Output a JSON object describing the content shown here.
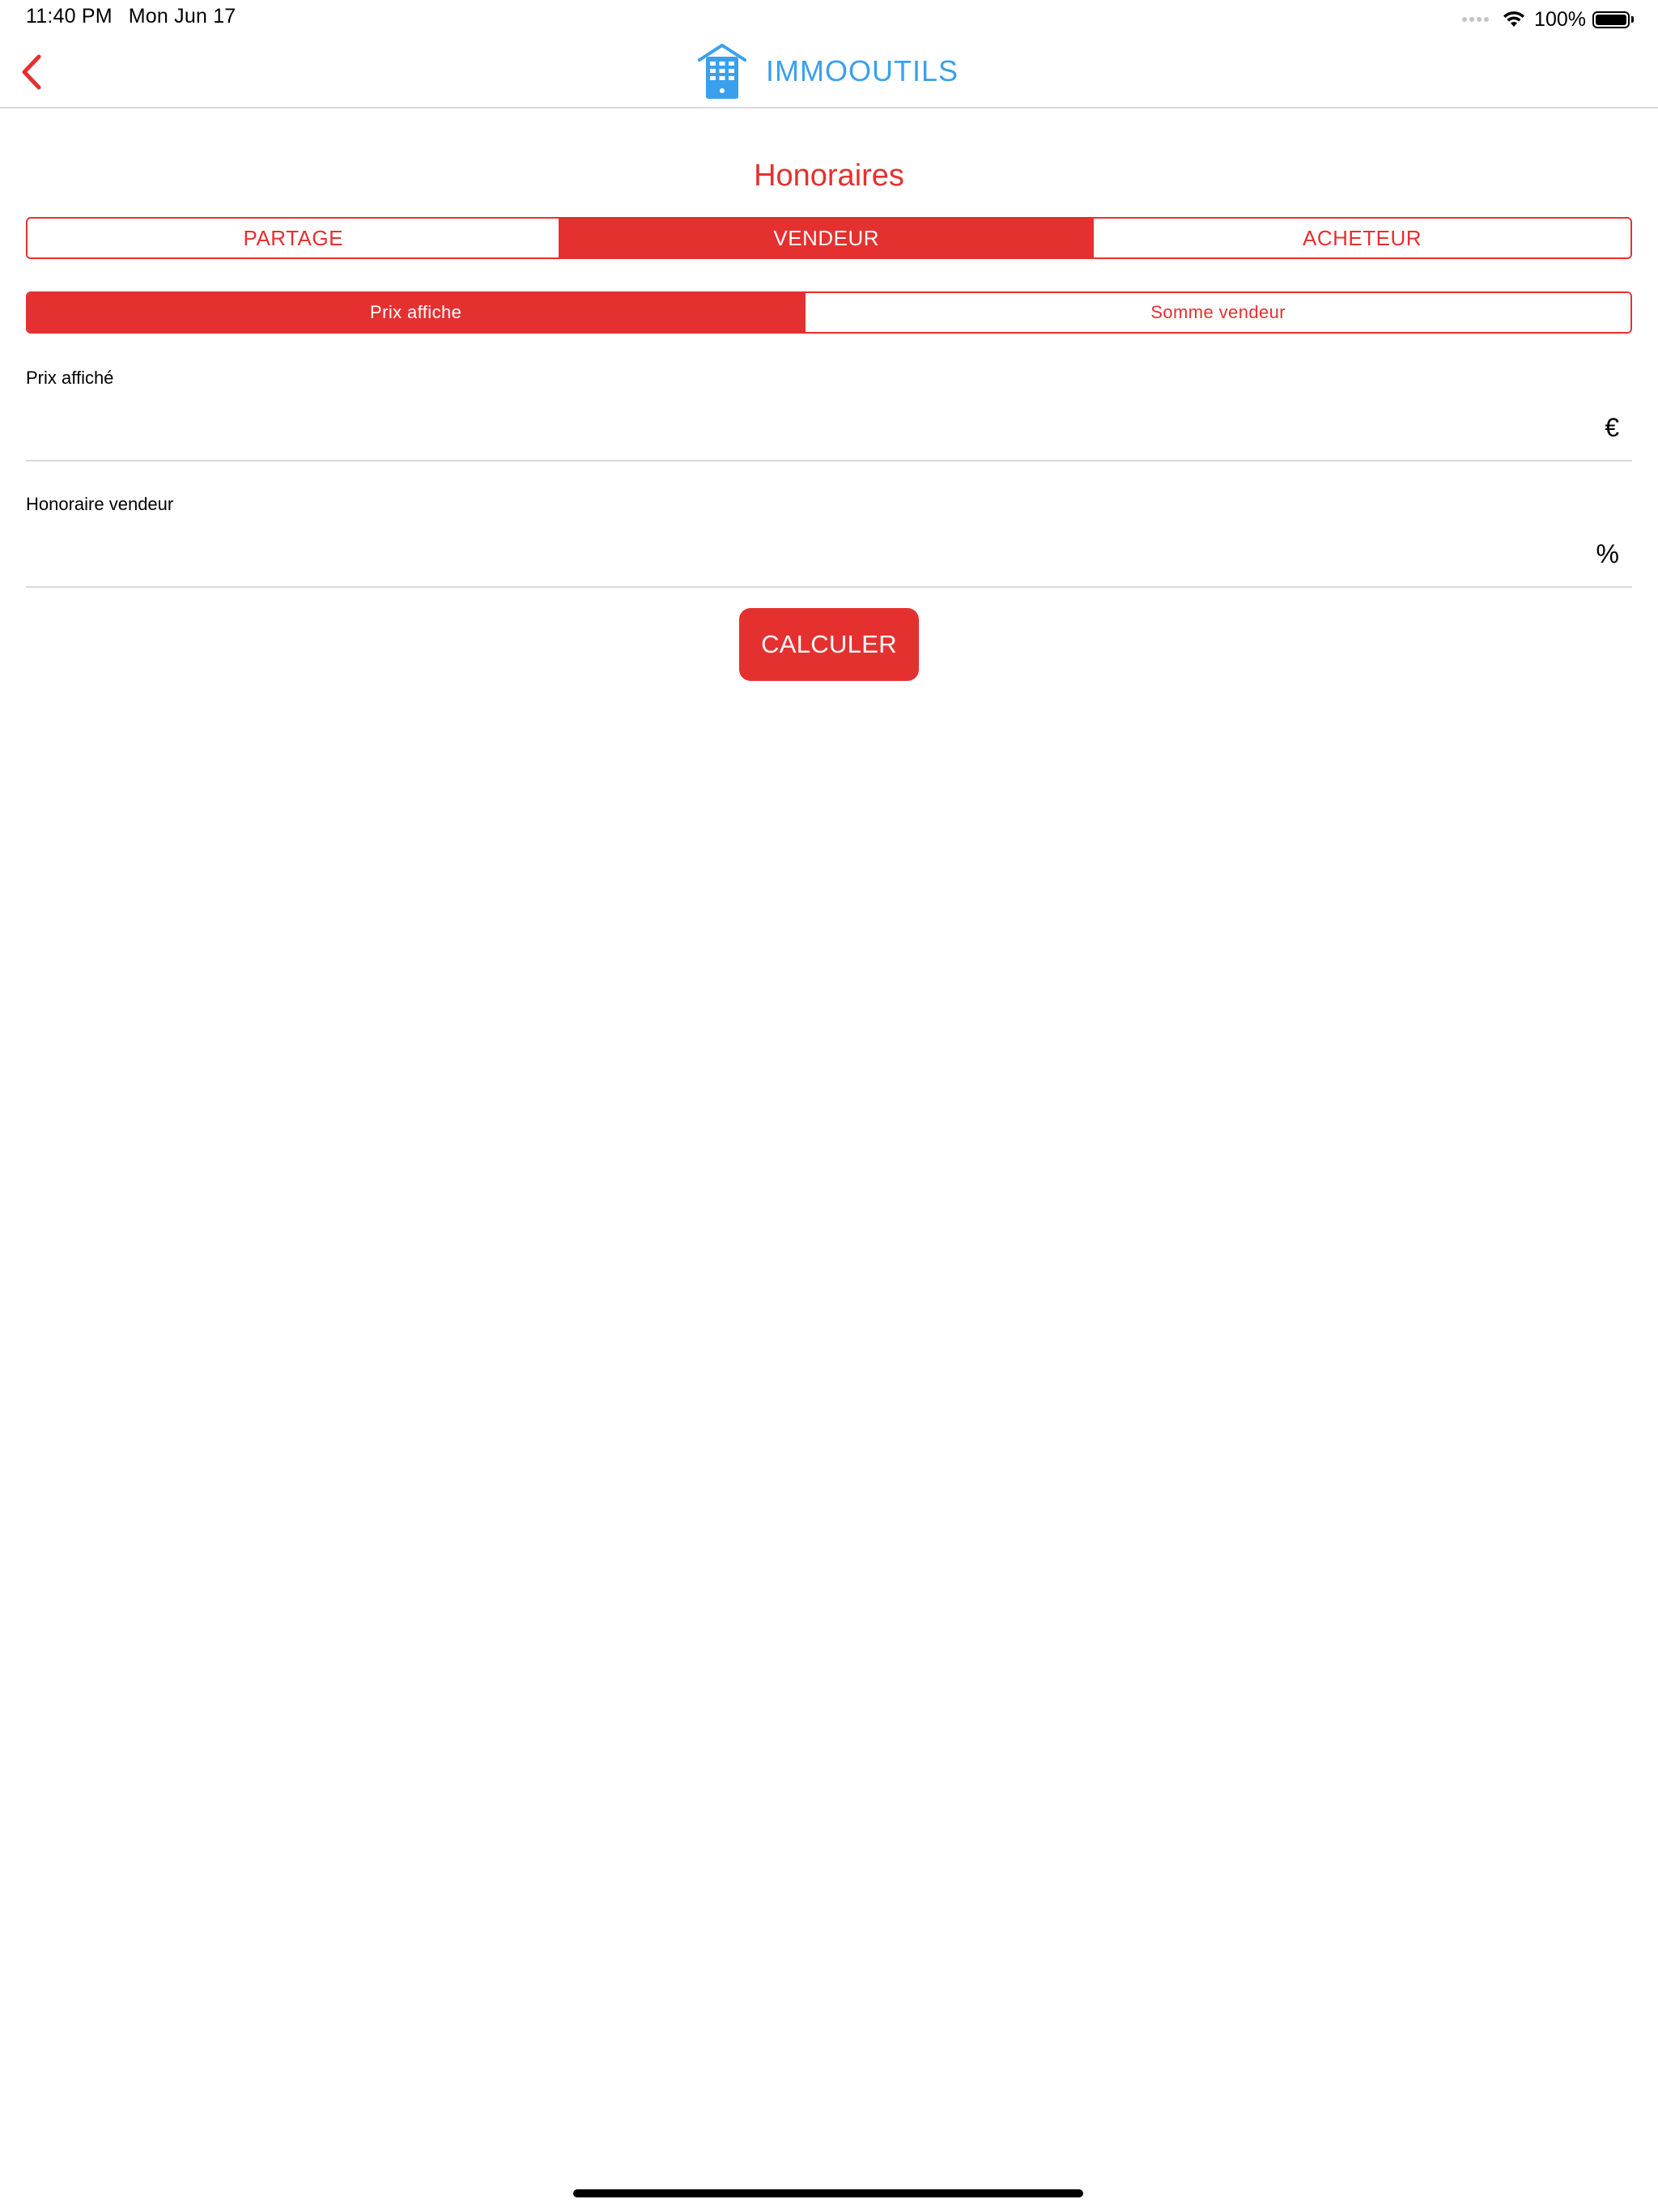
{
  "status_bar": {
    "time": "11:40 PM",
    "date": "Mon Jun 17",
    "battery": "100%"
  },
  "nav": {
    "brand_name": "IMMOOUTILS"
  },
  "page": {
    "title": "Honoraires"
  },
  "main_tabs": {
    "items": [
      {
        "label": "PARTAGE",
        "active": false
      },
      {
        "label": "VENDEUR",
        "active": true
      },
      {
        "label": "ACHETEUR",
        "active": false
      }
    ]
  },
  "sub_tabs": {
    "items": [
      {
        "label": "Prix affiche",
        "active": true
      },
      {
        "label": "Somme vendeur",
        "active": false
      }
    ]
  },
  "fields": {
    "prix": {
      "label": "Prix affiché",
      "value": "",
      "unit": "€"
    },
    "honoraire": {
      "label": "Honoraire vendeur",
      "value": "",
      "unit": "%"
    }
  },
  "actions": {
    "calculate_label": "CALCULER"
  },
  "colors": {
    "accent": "#e53030",
    "brand": "#3aa0ee",
    "divider": "#d9d9d9"
  }
}
